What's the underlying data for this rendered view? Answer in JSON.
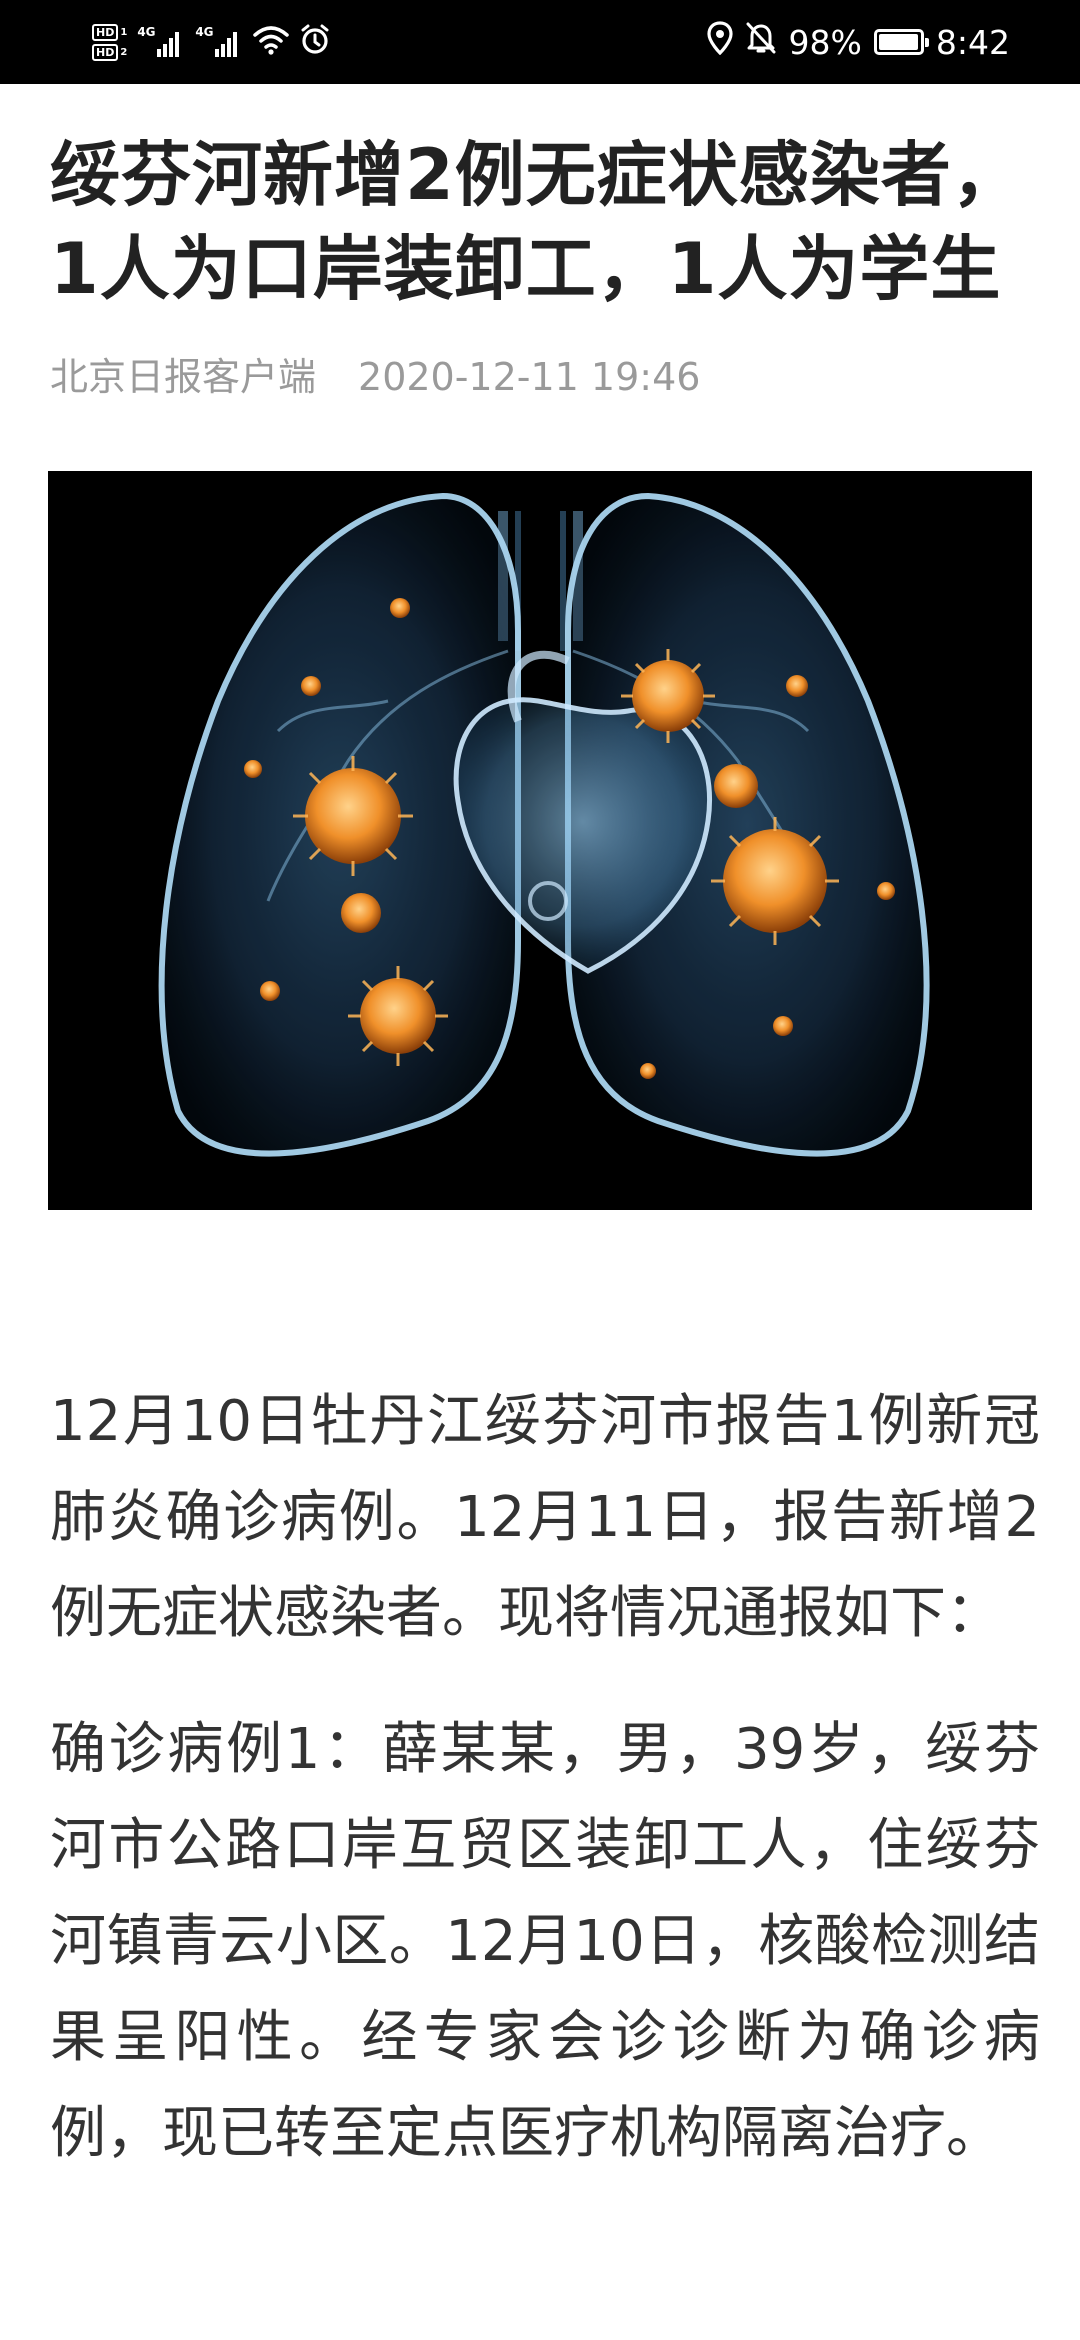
{
  "status_bar": {
    "hd1": "HD",
    "hd1_slot": "1",
    "hd2": "HD",
    "hd2_slot": "2",
    "network1": "4G",
    "network2": "4G",
    "battery_percent": "98%",
    "battery_level": 0.98,
    "time": "8:42",
    "icons": [
      "signal-icon",
      "wifi-icon",
      "alarm-icon",
      "location-icon",
      "mute-icon",
      "battery-icon"
    ]
  },
  "article": {
    "title_line1": "绥芬河新增2例无症状感染者，",
    "title_line2": "1人为口岸装卸工，1人为学生",
    "source": "北京日报客户端",
    "date": "2020-12-11 19:46",
    "image_desc_icon": "lung-virus-illustration",
    "paragraphs": [
      "12月10日牡丹江绥芬河市报告1例新冠肺炎确诊病例。12月11日，报告新增2例无症状感染者。现将情况通报如下：",
      "确诊病例1：薛某某，男，39岁，绥芬河市公路口岸互贸区装卸工人，住绥芬河镇青云小区。12月10日，核酸检测结果呈阳性。经专家会诊诊断为确诊病例，现已转至定点医疗机构隔离治疗。"
    ]
  }
}
